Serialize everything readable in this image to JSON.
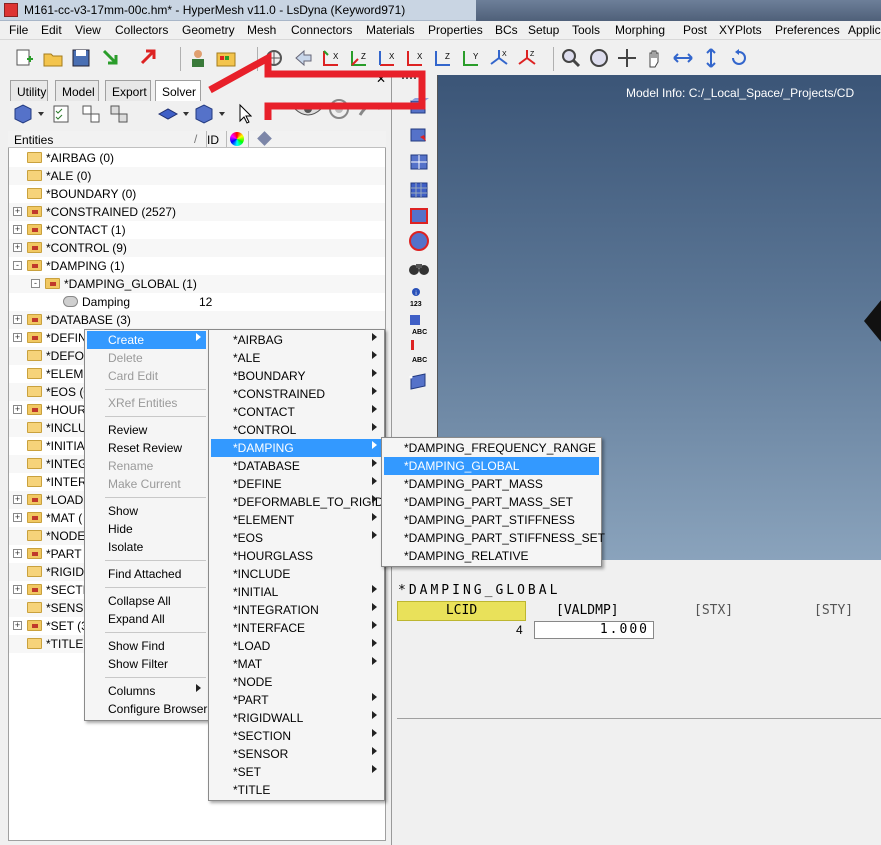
{
  "titlebar": {
    "title": "M161-cc-v3-17mm-00c.hm* - HyperMesh v11.0 - LsDyna (Keyword971)"
  },
  "menubar": [
    "File",
    "Edit",
    "View",
    "Collectors",
    "Geometry",
    "Mesh",
    "Connectors",
    "Materials",
    "Properties",
    "BCs",
    "Setup",
    "Tools",
    "Morphing",
    "Post",
    "XYPlots",
    "Preferences",
    "Applic"
  ],
  "tabs": [
    "Utility",
    "Model",
    "Export",
    "Solver"
  ],
  "tree": {
    "header": {
      "entities": "Entities",
      "id": "ID"
    },
    "rows": [
      {
        "label": "*AIRBAG (0)",
        "expander": "",
        "folder": "plain"
      },
      {
        "label": "*ALE (0)",
        "expander": "",
        "folder": "plain"
      },
      {
        "label": "*BOUNDARY (0)",
        "expander": "",
        "folder": "plain"
      },
      {
        "label": "*CONSTRAINED (2527)",
        "expander": "+",
        "folder": "data"
      },
      {
        "label": "*CONTACT (1)",
        "expander": "+",
        "folder": "data"
      },
      {
        "label": "*CONTROL (9)",
        "expander": "+",
        "folder": "data"
      },
      {
        "label": "*DAMPING (1)",
        "expander": "-",
        "folder": "data"
      },
      {
        "label": "*DAMPING_GLOBAL (1)",
        "expander": "-",
        "folder": "data",
        "indent": 1
      },
      {
        "label": "Damping",
        "expander": "",
        "folder": "",
        "indent": 2,
        "id": "12"
      },
      {
        "label": "*DATABASE (3)",
        "expander": "+",
        "folder": "data"
      },
      {
        "label": "*DEFIN",
        "expander": "+",
        "folder": "data"
      },
      {
        "label": "*DEFOR",
        "expander": "",
        "folder": "plain"
      },
      {
        "label": "*ELEME",
        "expander": "",
        "folder": "plain"
      },
      {
        "label": "*EOS (0",
        "expander": "",
        "folder": "plain"
      },
      {
        "label": "*HOUR",
        "expander": "+",
        "folder": "data"
      },
      {
        "label": "*INCLU",
        "expander": "",
        "folder": "plain"
      },
      {
        "label": "*INITIA",
        "expander": "",
        "folder": "plain"
      },
      {
        "label": "*INTEG",
        "expander": "",
        "folder": "plain"
      },
      {
        "label": "*INTER",
        "expander": "",
        "folder": "plain"
      },
      {
        "label": "*LOAD",
        "expander": "+",
        "folder": "data"
      },
      {
        "label": "*MAT (",
        "expander": "+",
        "folder": "data"
      },
      {
        "label": "*NODE",
        "expander": "",
        "folder": "plain"
      },
      {
        "label": "*PART",
        "expander": "+",
        "folder": "data"
      },
      {
        "label": "*RIGIDV",
        "expander": "",
        "folder": "plain"
      },
      {
        "label": "*SECTI",
        "expander": "+",
        "folder": "data"
      },
      {
        "label": "*SENSO",
        "expander": "",
        "folder": "plain"
      },
      {
        "label": "*SET (3",
        "expander": "+",
        "folder": "data"
      },
      {
        "label": "*TITLE",
        "expander": "",
        "folder": "plain"
      }
    ]
  },
  "context_menu": {
    "items": [
      {
        "label": "Create",
        "state": "highlighted",
        "submenu": true
      },
      {
        "label": "Delete",
        "state": "disabled"
      },
      {
        "label": "Card Edit",
        "state": "disabled"
      },
      {
        "sep": true
      },
      {
        "label": "XRef Entities",
        "state": "disabled"
      },
      {
        "sep": true
      },
      {
        "label": "Review",
        "state": "normal"
      },
      {
        "label": "Reset Review",
        "state": "normal"
      },
      {
        "label": "Rename",
        "state": "disabled"
      },
      {
        "label": "Make Current",
        "state": "disabled"
      },
      {
        "sep": true
      },
      {
        "label": "Show",
        "state": "normal"
      },
      {
        "label": "Hide",
        "state": "normal"
      },
      {
        "label": "Isolate",
        "state": "normal"
      },
      {
        "sep": true
      },
      {
        "label": "Find Attached",
        "state": "normal"
      },
      {
        "sep": true
      },
      {
        "label": "Collapse All",
        "state": "normal"
      },
      {
        "label": "Expand All",
        "state": "normal"
      },
      {
        "sep": true
      },
      {
        "label": "Show Find",
        "state": "normal"
      },
      {
        "label": "Show Filter",
        "state": "normal"
      },
      {
        "sep": true
      },
      {
        "label": "Columns",
        "state": "normal",
        "submenu": true
      },
      {
        "label": "Configure Browser",
        "state": "normal"
      }
    ]
  },
  "create_menu": {
    "items": [
      {
        "label": "*AIRBAG",
        "submenu": true
      },
      {
        "label": "*ALE",
        "submenu": true
      },
      {
        "label": "*BOUNDARY",
        "submenu": true
      },
      {
        "label": "*CONSTRAINED",
        "submenu": true
      },
      {
        "label": "*CONTACT",
        "submenu": true
      },
      {
        "label": "*CONTROL",
        "submenu": true
      },
      {
        "label": "*DAMPING",
        "submenu": true,
        "state": "highlighted"
      },
      {
        "label": "*DATABASE",
        "submenu": true
      },
      {
        "label": "*DEFINE",
        "submenu": true
      },
      {
        "label": "*DEFORMABLE_TO_RIGID",
        "submenu": true
      },
      {
        "label": "*ELEMENT",
        "submenu": true
      },
      {
        "label": "*EOS",
        "submenu": true
      },
      {
        "label": "*HOURGLASS",
        "submenu": false
      },
      {
        "label": "*INCLUDE",
        "submenu": false
      },
      {
        "label": "*INITIAL",
        "submenu": true
      },
      {
        "label": "*INTEGRATION",
        "submenu": true
      },
      {
        "label": "*INTERFACE",
        "submenu": true
      },
      {
        "label": "*LOAD",
        "submenu": true
      },
      {
        "label": "*MAT",
        "submenu": true
      },
      {
        "label": "*NODE",
        "submenu": false
      },
      {
        "label": "*PART",
        "submenu": true
      },
      {
        "label": "*RIGIDWALL",
        "submenu": true
      },
      {
        "label": "*SECTION",
        "submenu": true
      },
      {
        "label": "*SENSOR",
        "submenu": true
      },
      {
        "label": "*SET",
        "submenu": true
      },
      {
        "label": "*TITLE",
        "submenu": false
      }
    ]
  },
  "damping_menu": {
    "items": [
      {
        "label": "*DAMPING_FREQUENCY_RANGE"
      },
      {
        "label": "*DAMPING_GLOBAL",
        "state": "highlighted"
      },
      {
        "label": "*DAMPING_PART_MASS"
      },
      {
        "label": "*DAMPING_PART_MASS_SET"
      },
      {
        "label": "*DAMPING_PART_STIFFNESS"
      },
      {
        "label": "*DAMPING_PART_STIFFNESS_SET"
      },
      {
        "label": "*DAMPING_RELATIVE"
      }
    ]
  },
  "viewport": {
    "model_info": "Model Info: C:/_Local_Space/_Projects/CD"
  },
  "card": {
    "title": "*DAMPING_GLOBAL",
    "headers": {
      "lcid": "LCID",
      "valdmp": "[VALDMP]",
      "stx": "[STX]",
      "sty": "[STY]"
    },
    "values": {
      "lcid": "4",
      "valdmp": "1.000"
    }
  },
  "vtoolbar_labels": {
    "num": "123",
    "abc1": "ABC",
    "abc2": "ABC"
  },
  "colors": {
    "highlight": "#3399ff",
    "arrow": "#e8202a",
    "lcid_bg": "#e9e15a"
  }
}
